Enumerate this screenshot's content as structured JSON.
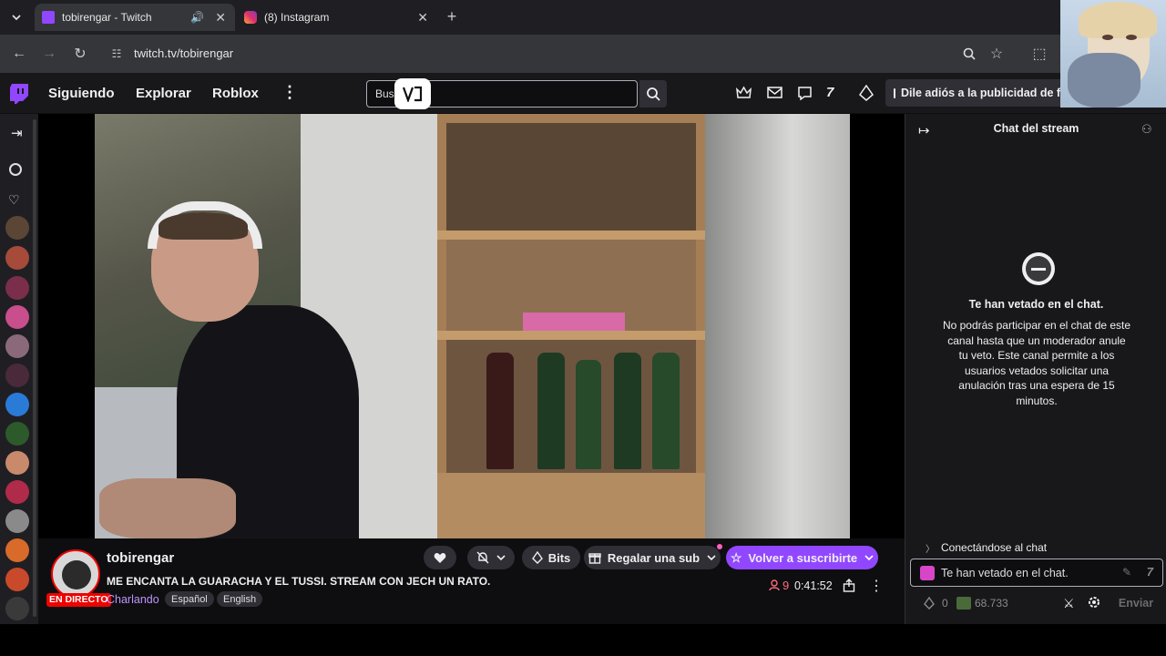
{
  "browser": {
    "tabs": [
      {
        "title": "tobirengar - Twitch",
        "active": true
      },
      {
        "title": "(8) Instagram",
        "active": false
      }
    ],
    "url": "twitch.tv/tobirengar"
  },
  "topnav": {
    "links": [
      "Siguiendo",
      "Explorar",
      "Roblox"
    ],
    "search_value": "Bus",
    "ad_text": "Dile adiós a la publicidad de for"
  },
  "stream": {
    "channel": "tobirengar",
    "title": "ME ENCANTA LA GUARACHA Y EL TUSSI. STREAM CON JECH UN RATO.",
    "live_badge": "EN DIRECTO",
    "category": "Charlando",
    "tags": [
      "Español",
      "English"
    ],
    "viewers": "9",
    "uptime": "0:41:52",
    "buttons": {
      "bits": "Bits",
      "gift_sub": "Regalar una sub",
      "resub": "Volver a suscribirte"
    }
  },
  "chat": {
    "header": "Chat del stream",
    "banned_title": "Te han vetado en el chat.",
    "banned_body": "No podrás participar en el chat de este canal hasta que un moderador anule tu veto. Este canal permite a los usuarios vetados solicitar una anulación tras una espera de 15 minutos.",
    "connecting": "Conectándose al chat",
    "input_placeholder": "Te han vetado en el chat.",
    "bits_count": "0",
    "points": "68.733",
    "send_label": "Enviar"
  },
  "colors": {
    "twitch_purple": "#9147ff",
    "live_red": "#eb0400",
    "category_purple": "#bf94ff"
  },
  "icons": [
    "twitch-logo-icon",
    "search-icon",
    "crown-icon",
    "mail-icon",
    "chat-bubble-icon",
    "bits-icon",
    "heart-icon",
    "bell-off-icon",
    "gift-icon",
    "star-icon",
    "share-icon",
    "settings-icon",
    "viewer-icon"
  ]
}
